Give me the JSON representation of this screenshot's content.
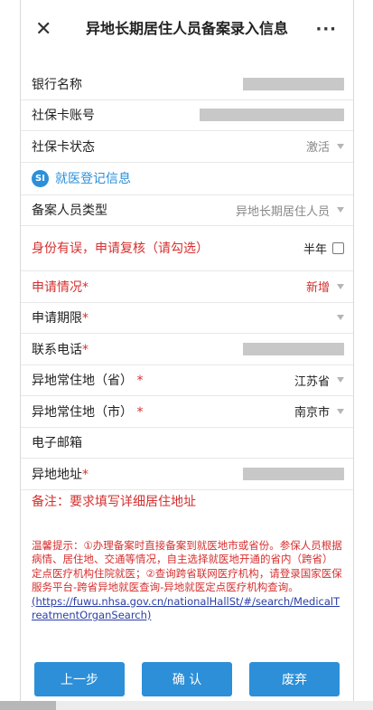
{
  "header": {
    "title": "异地长期居住人员备案录入信息",
    "close_glyph": "✕",
    "more_glyph": "···"
  },
  "form": {
    "bank_name": {
      "label": "银行名称"
    },
    "card_no": {
      "label": "社保卡账号"
    },
    "card_status": {
      "label": "社保卡状态",
      "value": "激活"
    },
    "section": {
      "icon_text": "SI",
      "title": "就医登记信息"
    },
    "person_type": {
      "label": "备案人员类型",
      "value": "异地长期居住人员"
    },
    "identity_error": {
      "label": "身份有误，申请复核（请勾选）",
      "option": "半年"
    },
    "apply_status": {
      "label": "申请情况",
      "star": "*",
      "value": "新增"
    },
    "apply_period": {
      "label": "申请期限",
      "star": "*",
      "value": ""
    },
    "phone": {
      "label": "联系电话",
      "star": "*"
    },
    "province": {
      "label": "异地常住地（省）",
      "star": " *",
      "value": "江苏省"
    },
    "city": {
      "label": "异地常住地（市）",
      "star": " *",
      "value": "南京市"
    },
    "email": {
      "label": "电子邮箱"
    },
    "address": {
      "label": "异地地址",
      "star": "*"
    },
    "note": "备注：要求填写详细居住地址"
  },
  "tips": {
    "text": "温馨提示：①办理备案时直接备案到就医地市或省份。参保人员根据病情、居住地、交通等情况，自主选择就医地开通的省内（跨省）定点医疗机构住院就医；②查询跨省联网医疗机构，请登录国家医保服务平台-跨省异地就医查询-异地就医定点医疗机构查询。",
    "link": "(https://fuwu.nhsa.gov.cn/nationalHallSt/#/search/MedicalTreatmentOrganSearch)"
  },
  "buttons": {
    "prev": "上一步",
    "confirm": "确 认",
    "discard": "废弃"
  },
  "colors": {
    "accent": "#2c8fd8",
    "required_red": "#d62f2f",
    "link": "#2a3ea8"
  }
}
